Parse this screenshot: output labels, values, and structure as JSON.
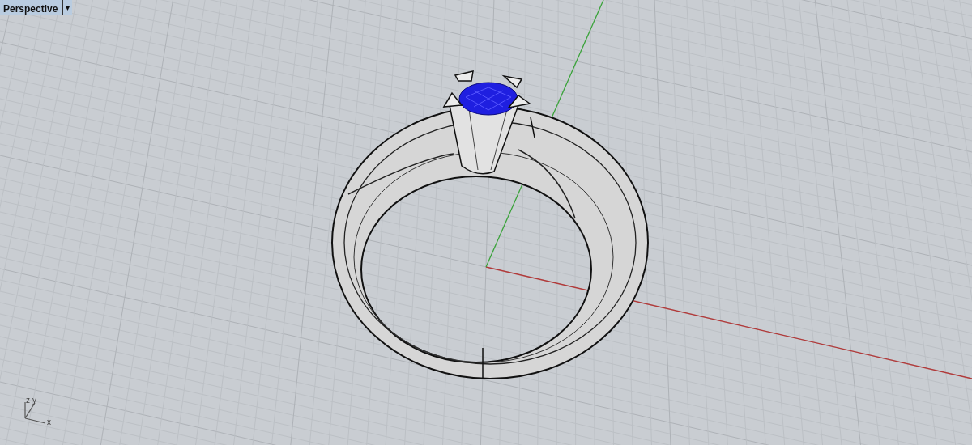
{
  "viewport": {
    "title": "Perspective",
    "menu_glyph": "▾"
  },
  "axis_triad": {
    "labels": [
      "z",
      "y",
      "x"
    ]
  }
}
